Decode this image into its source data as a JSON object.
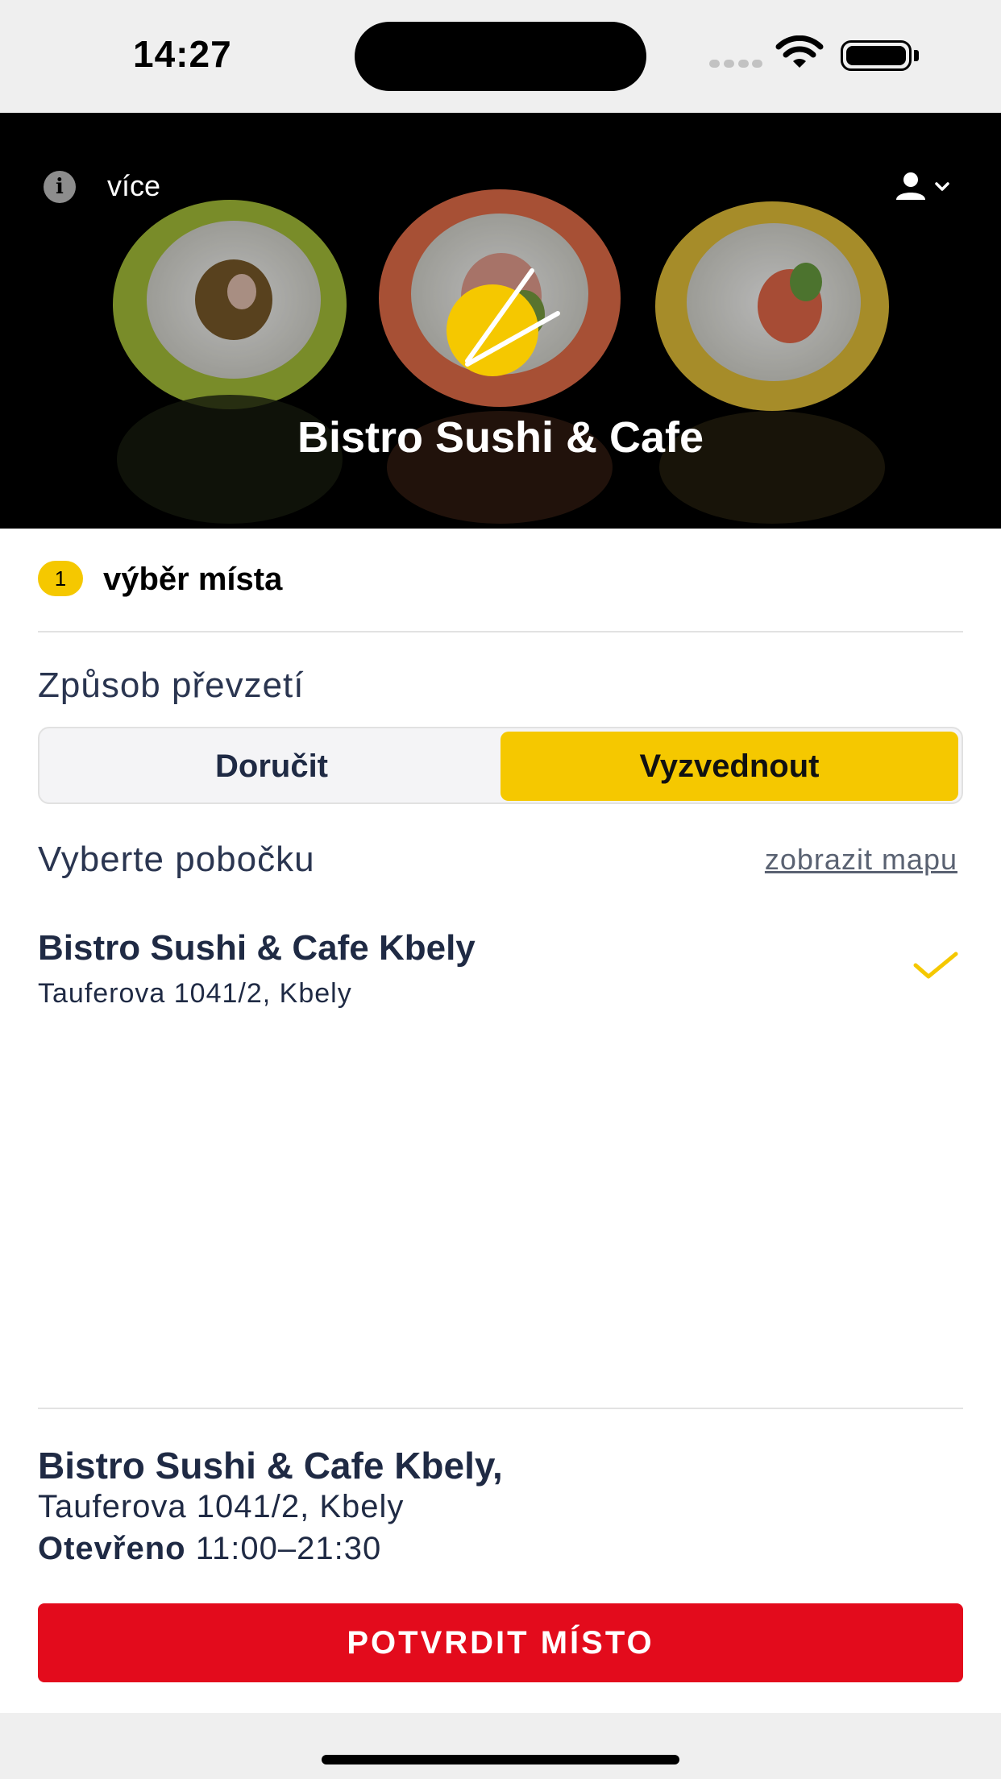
{
  "status_bar": {
    "time": "14:27"
  },
  "header": {
    "more_label": "více",
    "title": "Bistro Sushi & Cafe",
    "info_icon": "info-icon",
    "user_icon": "user-icon"
  },
  "step": {
    "number": "1",
    "label": "výběr místa"
  },
  "pickup": {
    "label": "Způsob převzetí",
    "options": [
      {
        "label": "Doručit",
        "selected": false
      },
      {
        "label": "Vyzvednout",
        "selected": true
      }
    ]
  },
  "branch_section": {
    "label": "Vyberte pobočku",
    "map_link": "zobrazit mapu",
    "items": [
      {
        "name": "Bistro Sushi & Cafe Kbely",
        "address": "Tauferova 1041/2, Kbely",
        "selected": true
      }
    ]
  },
  "summary": {
    "name": "Bistro Sushi & Cafe Kbely,",
    "address": "Tauferova 1041/2, Kbely",
    "hours_label": "Otevřeno",
    "hours": "11:00–21:30"
  },
  "confirm_button": "POTVRDIT MÍSTO",
  "colors": {
    "accent": "#f5c800",
    "primary": "#e30b1c",
    "text": "#1f2a44"
  }
}
